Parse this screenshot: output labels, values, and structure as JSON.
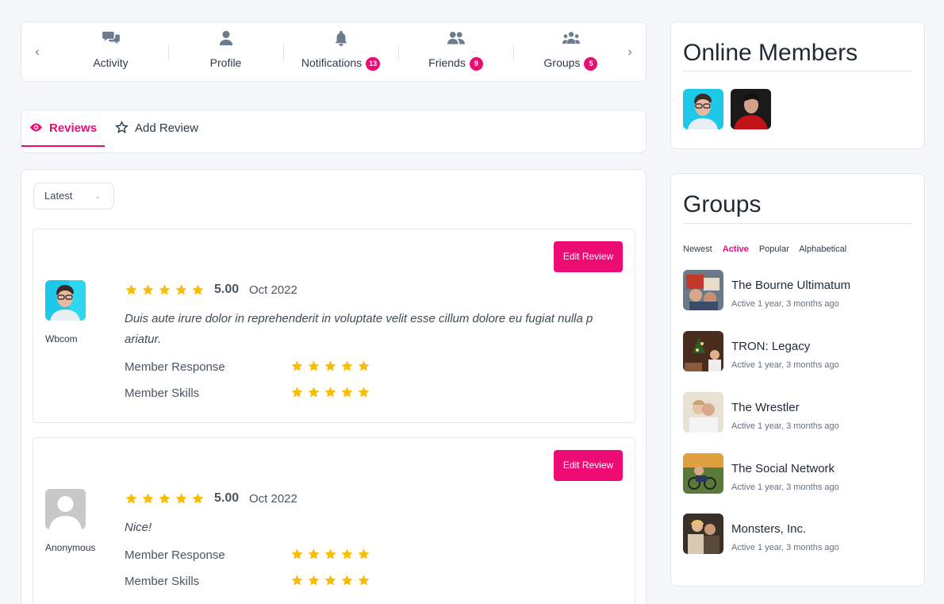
{
  "nav": {
    "items": [
      {
        "label": "Activity",
        "badge": ""
      },
      {
        "label": "Profile",
        "badge": ""
      },
      {
        "label": "Notifications",
        "badge": "13"
      },
      {
        "label": "Friends",
        "badge": "9"
      },
      {
        "label": "Groups",
        "badge": "5"
      }
    ],
    "prev_icon": "chevron-left-icon",
    "next_icon": "chevron-right-icon"
  },
  "tabs": {
    "reviews": "Reviews",
    "add_review": "Add Review"
  },
  "sort": {
    "selected": "Latest"
  },
  "reviews": [
    {
      "author": "Wbcom",
      "rating": 5,
      "score": "5.00",
      "date": "Oct 2022",
      "text_line1": "Duis aute irure dolor in reprehenderit in voluptate velit esse cillum dolore eu fugiat nulla p",
      "text_line2": "ariatur.",
      "criteria": [
        {
          "label": "Member Response",
          "rating": 5
        },
        {
          "label": "Member Skills",
          "rating": 5
        }
      ],
      "edit_label": "Edit Review"
    },
    {
      "author": "Anonymous",
      "rating": 5,
      "score": "5.00",
      "date": "Oct 2022",
      "text_line1": "Nice!",
      "text_line2": "",
      "criteria": [
        {
          "label": "Member Response",
          "rating": 5
        },
        {
          "label": "Member Skills",
          "rating": 5
        }
      ],
      "edit_label": "Edit Review"
    }
  ],
  "online_members": {
    "title": "Online Members"
  },
  "groups": {
    "title": "Groups",
    "filters": [
      "Newest",
      "Active",
      "Popular",
      "Alphabetical"
    ],
    "active_filter": "Active",
    "items": [
      {
        "name": "The Bourne Ultimatum",
        "meta": "Active 1 year, 3 months ago"
      },
      {
        "name": "TRON: Legacy",
        "meta": "Active 1 year, 3 months ago"
      },
      {
        "name": "The Wrestler",
        "meta": "Active 1 year, 3 months ago"
      },
      {
        "name": "The Social Network",
        "meta": "Active 1 year, 3 months ago"
      },
      {
        "name": "Monsters, Inc.",
        "meta": "Active 1 year, 3 months ago"
      }
    ]
  },
  "colors": {
    "accent": "#ec0c74",
    "star": "#fbbc05"
  }
}
